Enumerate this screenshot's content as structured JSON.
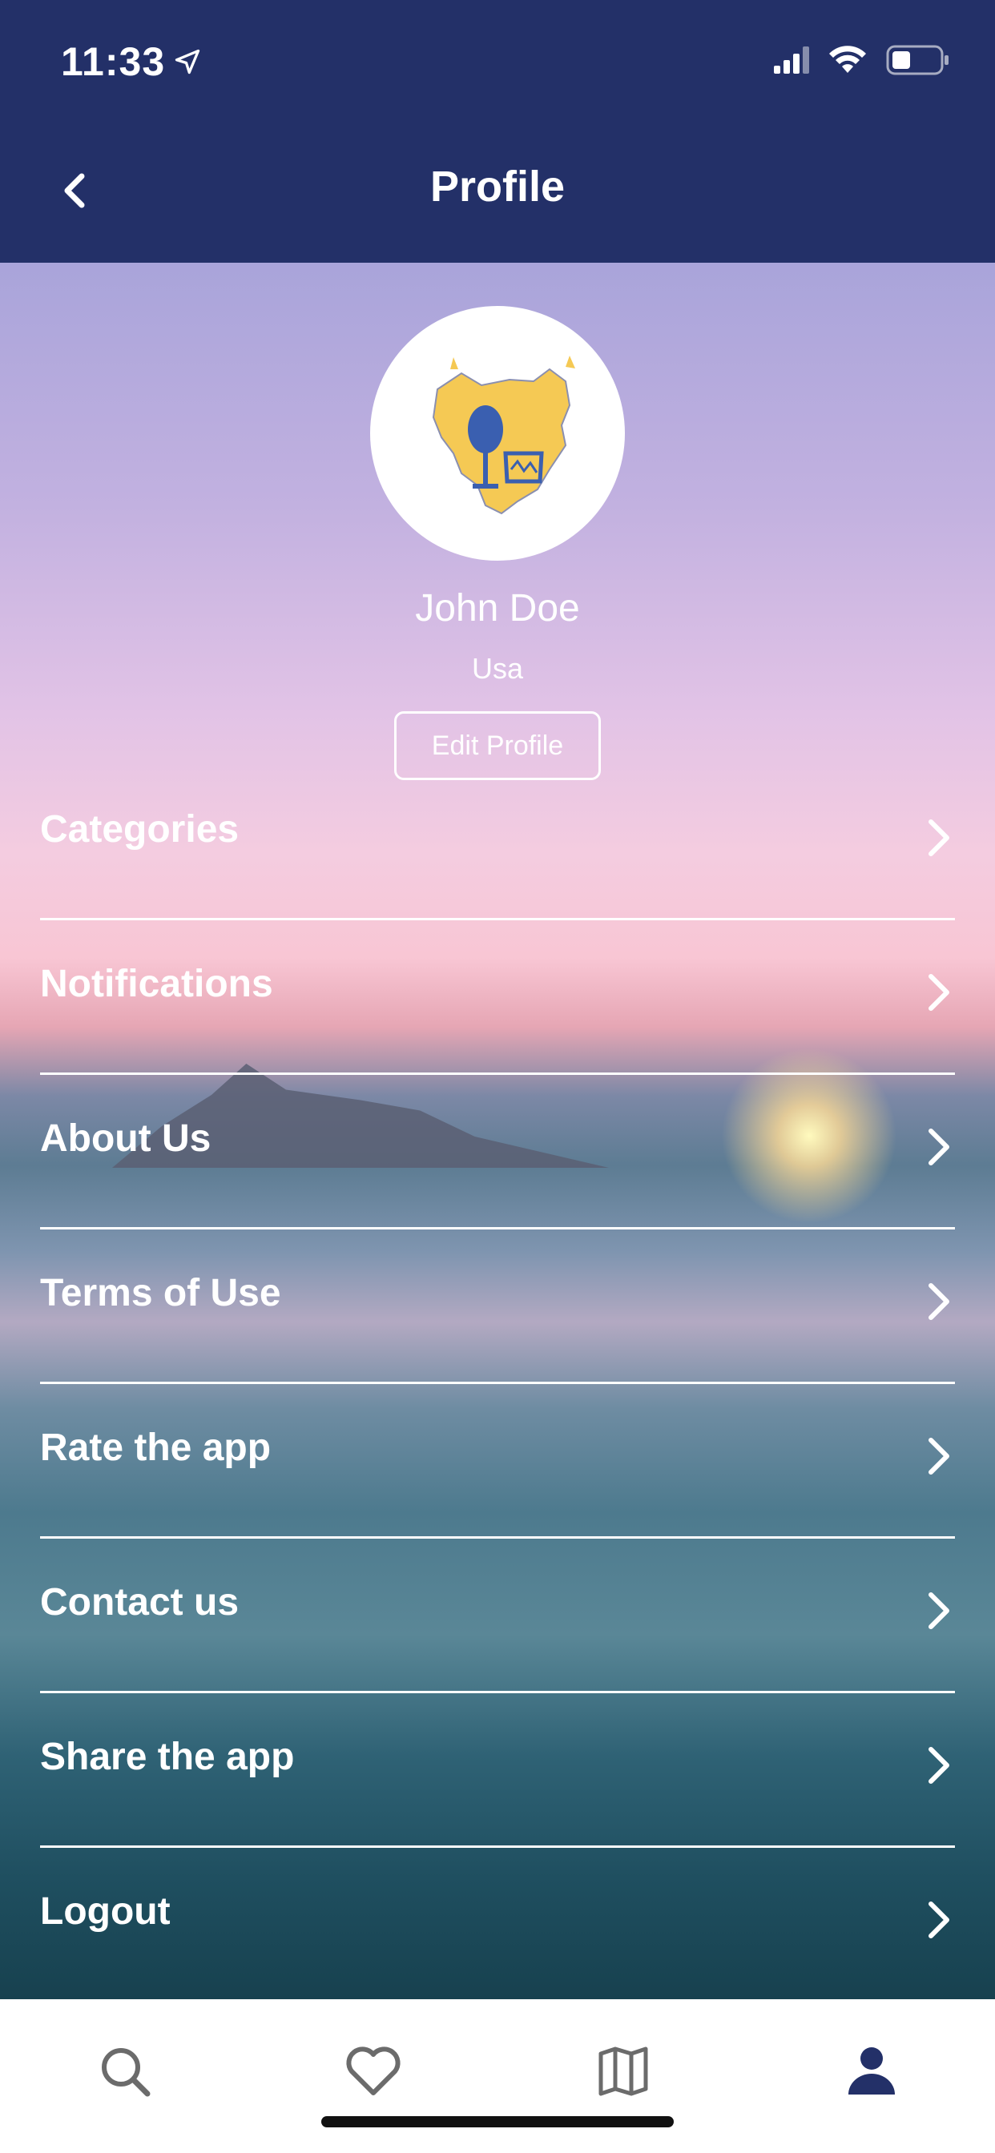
{
  "status_bar": {
    "time": "11:33"
  },
  "header": {
    "title": "Profile"
  },
  "profile": {
    "name": "John Doe",
    "location": "Usa",
    "edit_label": "Edit Profile"
  },
  "menu": {
    "items": [
      {
        "label": "Categories"
      },
      {
        "label": "Notifications"
      },
      {
        "label": "About Us"
      },
      {
        "label": "Terms of Use"
      },
      {
        "label": "Rate the app"
      },
      {
        "label": "Contact us"
      },
      {
        "label": "Share the app"
      },
      {
        "label": "Logout"
      }
    ]
  },
  "tab_bar": {
    "tabs": [
      {
        "icon": "search-icon"
      },
      {
        "icon": "heart-icon"
      },
      {
        "icon": "map-icon"
      },
      {
        "icon": "person-icon",
        "active": true
      }
    ]
  },
  "colors": {
    "header_bg": "#233068",
    "accent": "#233068",
    "tab_inactive": "#6b6b6b"
  }
}
